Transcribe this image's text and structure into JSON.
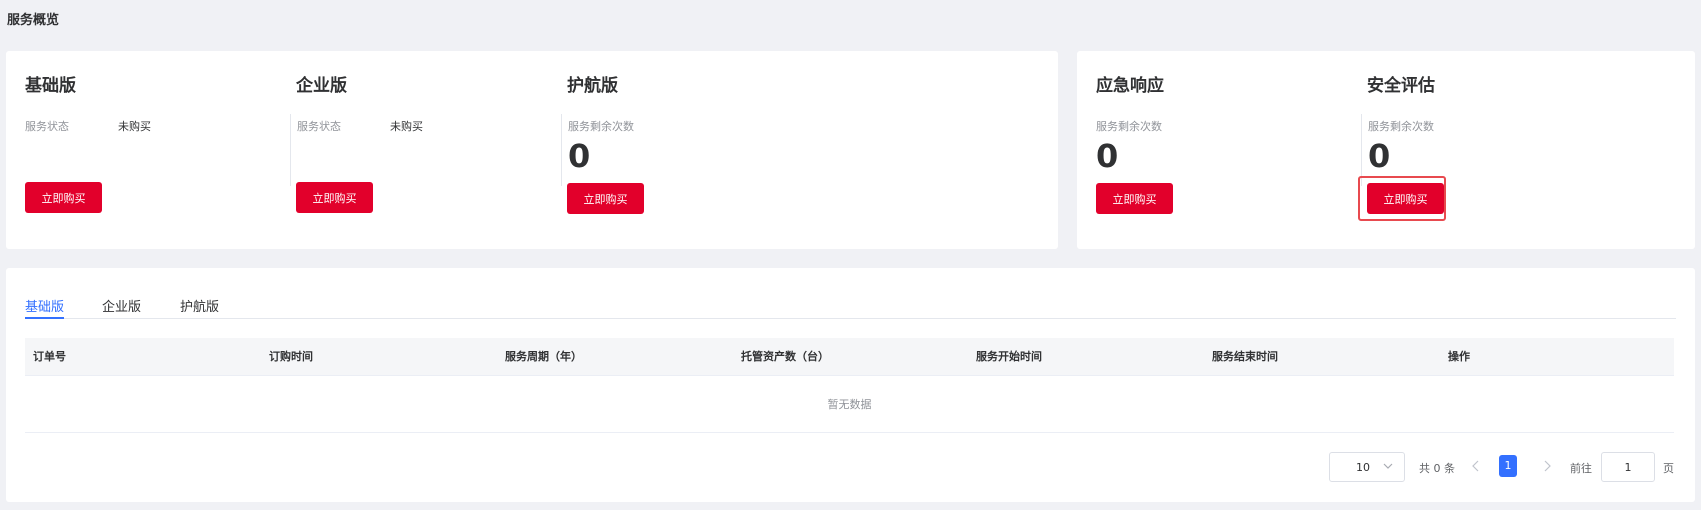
{
  "page": {
    "title": "服务概览"
  },
  "packages": {
    "basic": {
      "title": "基础版",
      "status_label": "服务状态",
      "status_value": "未购买",
      "buy_label": "立即购买"
    },
    "enterprise": {
      "title": "企业版",
      "status_label": "服务状态",
      "status_value": "未购买",
      "buy_label": "立即购买"
    },
    "escort": {
      "title": "护航版",
      "remaining_label": "服务剩余次数",
      "remaining_value": "0",
      "buy_label": "立即购买"
    }
  },
  "services": {
    "emergency": {
      "title": "应急响应",
      "remaining_label": "服务剩余次数",
      "remaining_value": "0",
      "buy_label": "立即购买"
    },
    "assessment": {
      "title": "安全评估",
      "remaining_label": "服务剩余次数",
      "remaining_value": "0",
      "buy_label": "立即购买"
    }
  },
  "orders": {
    "tabs": [
      {
        "label": "基础版",
        "active": true
      },
      {
        "label": "企业版",
        "active": false
      },
      {
        "label": "护航版",
        "active": false
      }
    ],
    "columns": [
      "订单号",
      "订购时间",
      "服务周期（年）",
      "托管资产数（台）",
      "服务开始时间",
      "服务结束时间",
      "操作"
    ],
    "empty_text": "暂无数据"
  },
  "pagination": {
    "page_size": "10",
    "total_text": "共 0 条",
    "current_page": "1",
    "goto_label": "前往",
    "goto_value": "1",
    "page_suffix": "页"
  },
  "colors": {
    "accent": "#3370ff",
    "buy_button": "#e2002b",
    "highlight": "#e84a4f"
  },
  "icons": {
    "select_arrow": "chevron-down-icon",
    "prev": "chevron-left-icon",
    "next": "chevron-right-icon"
  }
}
